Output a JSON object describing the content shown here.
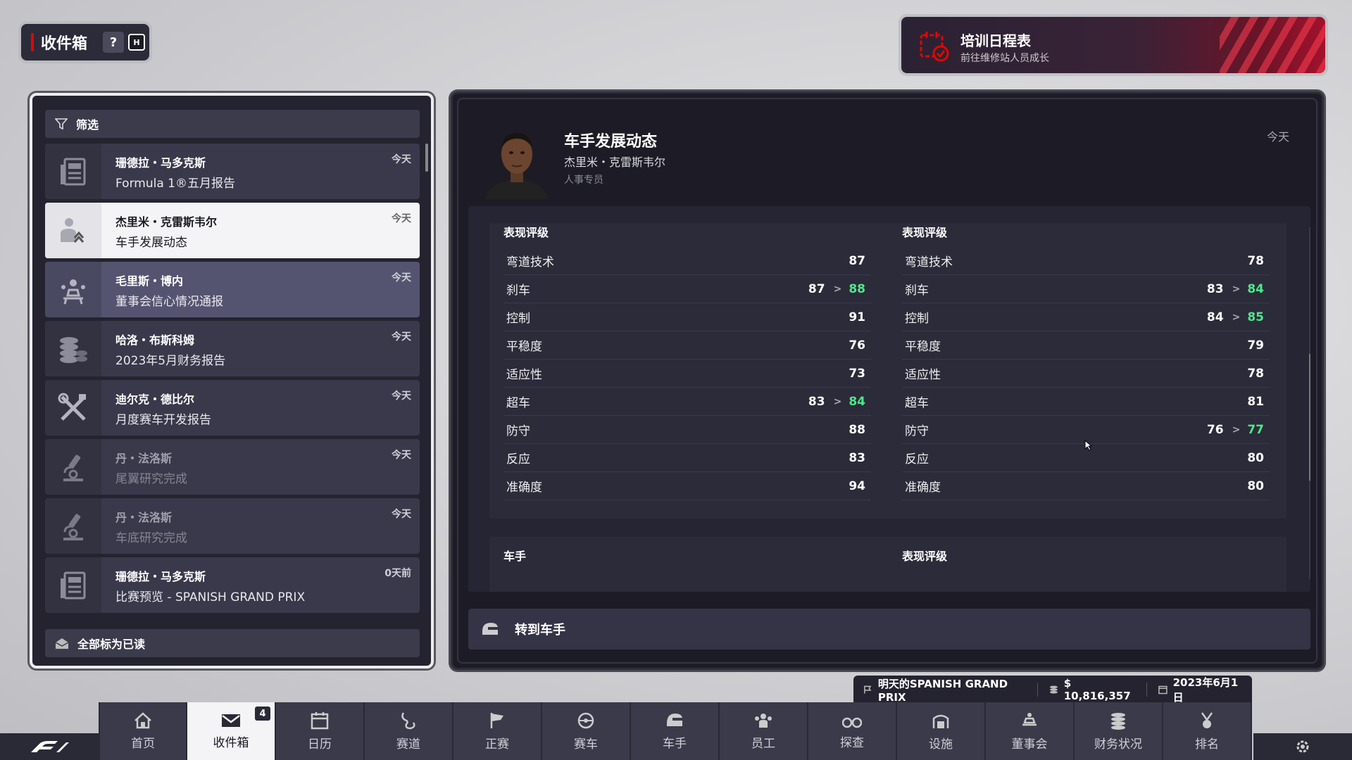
{
  "header": {
    "title": "收件箱",
    "help": "?",
    "hotkey": "H"
  },
  "training": {
    "title": "培训日程表",
    "subtitle": "前往维修站人员成长"
  },
  "inbox": {
    "filter_label": "筛选",
    "mark_all_read": "全部标为已读",
    "messages": [
      {
        "from": "珊德拉・马多克斯",
        "subject": "Formula 1®五月报告",
        "time": "今天",
        "icon": "newspaper-icon"
      },
      {
        "from": "杰里米・克雷斯韦尔",
        "subject": "车手发展动态",
        "time": "今天",
        "icon": "person-up-icon"
      },
      {
        "from": "毛里斯・博内",
        "subject": "董事会信心情况通报",
        "time": "今天",
        "icon": "board-icon"
      },
      {
        "from": "哈洛・布斯科姆",
        "subject": "2023年5月财务报告",
        "time": "今天",
        "icon": "coins-icon"
      },
      {
        "from": "迪尔克・德比尔",
        "subject": "月度赛车开发报告",
        "time": "今天",
        "icon": "tools-icon"
      },
      {
        "from": "丹・法洛斯",
        "subject": "尾翼研究完成",
        "time": "今天",
        "icon": "microscope-icon"
      },
      {
        "from": "丹・法洛斯",
        "subject": "车底研究完成",
        "time": "今天",
        "icon": "microscope-icon"
      },
      {
        "from": "珊德拉・马多克斯",
        "subject": "比赛预览 - SPANISH GRAND PRIX",
        "time": "0天前",
        "icon": "newspaper-icon"
      }
    ]
  },
  "detail": {
    "title": "车手发展动态",
    "name": "杰里米・克雷斯韦尔",
    "role": "人事专员",
    "date": "今天",
    "left_card": {
      "title": "表现评级",
      "rows": [
        {
          "name": "弯道技术",
          "value": "87",
          "new": ""
        },
        {
          "name": "刹车",
          "value": "87",
          "new": "88"
        },
        {
          "name": "控制",
          "value": "91",
          "new": ""
        },
        {
          "name": "平稳度",
          "value": "76",
          "new": ""
        },
        {
          "name": "适应性",
          "value": "73",
          "new": ""
        },
        {
          "name": "超车",
          "value": "83",
          "new": "84"
        },
        {
          "name": "防守",
          "value": "88",
          "new": ""
        },
        {
          "name": "反应",
          "value": "83",
          "new": ""
        },
        {
          "name": "准确度",
          "value": "94",
          "new": ""
        }
      ]
    },
    "right_card": {
      "title": "表现评级",
      "rows": [
        {
          "name": "弯道技术",
          "value": "78",
          "new": ""
        },
        {
          "name": "刹车",
          "value": "83",
          "new": "84"
        },
        {
          "name": "控制",
          "value": "84",
          "new": "85"
        },
        {
          "name": "平稳度",
          "value": "79",
          "new": ""
        },
        {
          "name": "适应性",
          "value": "78",
          "new": ""
        },
        {
          "name": "超车",
          "value": "81",
          "new": ""
        },
        {
          "name": "防守",
          "value": "76",
          "new": "77"
        },
        {
          "name": "反应",
          "value": "80",
          "new": ""
        },
        {
          "name": "准确度",
          "value": "80",
          "new": ""
        }
      ]
    },
    "lower_left_title": "车手",
    "lower_right_title": "表现评级",
    "goto_label": "转到车手"
  },
  "status": {
    "next_race": "明天的SPANISH GRAND PRIX",
    "money": "$ 10,816,357",
    "date": "2023年6月1日"
  },
  "nav": {
    "items": [
      {
        "label": "首页",
        "icon": "home-icon"
      },
      {
        "label": "收件箱",
        "icon": "mail-icon",
        "badge": "4"
      },
      {
        "label": "日历",
        "icon": "calendar-icon"
      },
      {
        "label": "赛道",
        "icon": "track-icon"
      },
      {
        "label": "正赛",
        "icon": "flag-icon"
      },
      {
        "label": "赛车",
        "icon": "car-icon"
      },
      {
        "label": "车手",
        "icon": "helmet-icon"
      },
      {
        "label": "员工",
        "icon": "staff-icon"
      },
      {
        "label": "探查",
        "icon": "binoculars-icon"
      },
      {
        "label": "设施",
        "icon": "facility-icon"
      },
      {
        "label": "董事会",
        "icon": "board-icon"
      },
      {
        "label": "财务状况",
        "icon": "coins-icon"
      },
      {
        "label": "排名",
        "icon": "trophy-icon"
      }
    ]
  },
  "colors": {
    "accent_red": "#e10600",
    "improve_green": "#4de88a",
    "panel_dark": "#24232f"
  }
}
